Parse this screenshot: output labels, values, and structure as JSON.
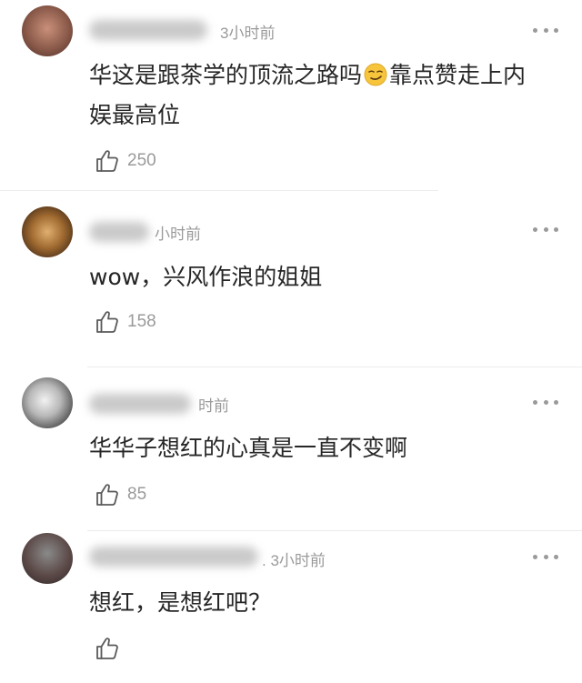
{
  "comments": [
    {
      "username": "",
      "timestamp": "3小时前",
      "text_line1": "华这是跟茶学的顶流之路吗",
      "text_line1_after_emoji": "靠点赞走上内",
      "text_line2": "娱最高位",
      "emoji": "smirk-emoji",
      "likes": "250"
    },
    {
      "username": "",
      "timestamp": "小时前",
      "text": "wow，兴风作浪的姐姐",
      "likes": "158"
    },
    {
      "username": "",
      "timestamp": "时前",
      "text": "华华子想红的心真是一直不变啊",
      "likes": "85"
    },
    {
      "username": "",
      "timestamp": ". 3小时前",
      "text": "想红，是想红吧？",
      "likes": ""
    }
  ],
  "colors": {
    "text": "#262626",
    "meta": "#9a9a9a",
    "divider": "#ececec"
  }
}
